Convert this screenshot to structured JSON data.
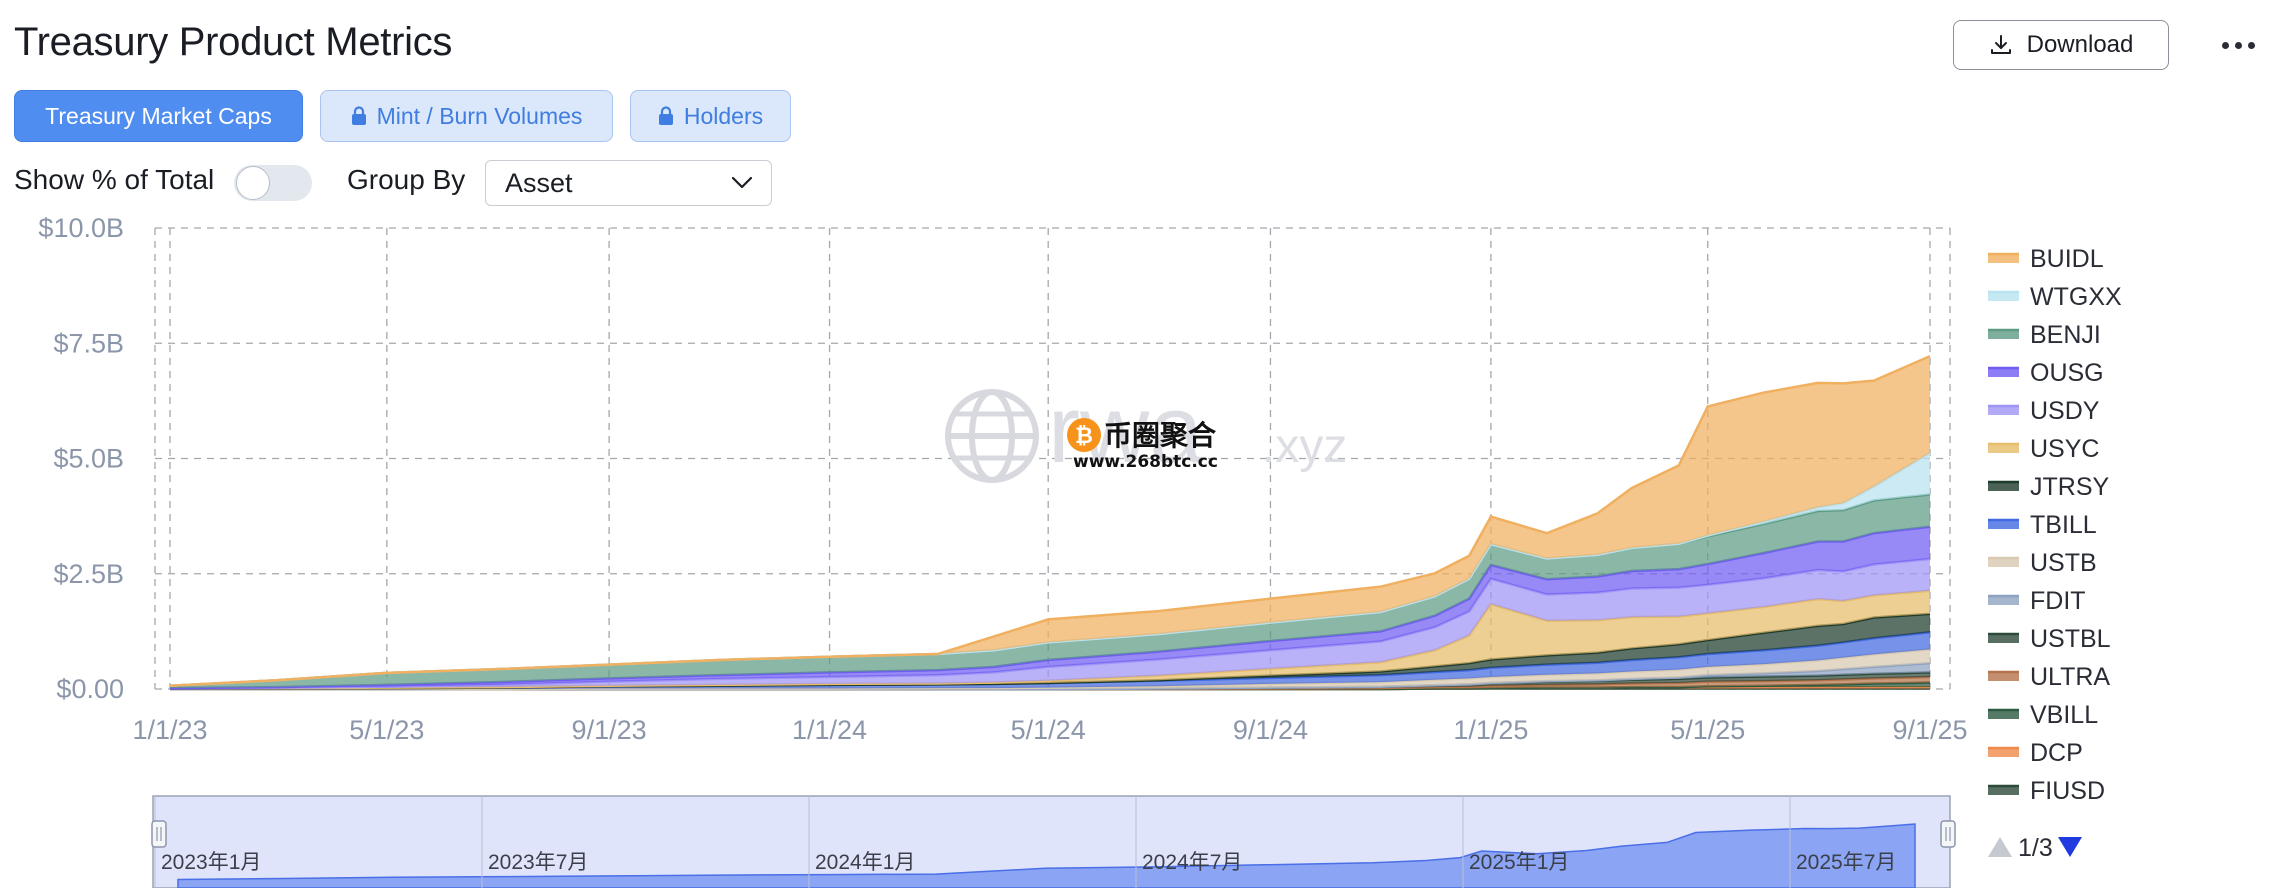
{
  "header": {
    "title": "Treasury Product Metrics",
    "download_label": "Download",
    "more_icon": "ellipsis-icon"
  },
  "tabs": [
    {
      "label": "Treasury Market Caps",
      "active": true
    },
    {
      "label": "Mint / Burn Volumes",
      "locked": true
    },
    {
      "label": "Holders",
      "locked": true
    }
  ],
  "controls": {
    "show_pct_label": "Show % of Total",
    "show_pct_on": false,
    "group_by_label": "Group By",
    "group_by_value": "Asset"
  },
  "watermark": {
    "text1": "rwa",
    "text2": ".xyz",
    "badge_text": "币圈聚合",
    "badge_url": "www.268btc.cc"
  },
  "pagination": {
    "text": "1/3"
  },
  "colors": {
    "accent": "#4f8df0"
  },
  "navigator": {
    "labels": [
      "2023年1月",
      "2023年7月",
      "2024年1月",
      "2024年7月",
      "2025年1月",
      "2025年7月"
    ]
  },
  "chart_data": {
    "type": "area",
    "stacked": true,
    "x": [
      "1/1/23",
      "3/1/23",
      "5/1/23",
      "7/1/23",
      "9/1/23",
      "11/1/23",
      "1/1/24",
      "3/1/24",
      "4/1/24",
      "5/1/24",
      "7/1/24",
      "9/1/24",
      "11/1/24",
      "12/1/24",
      "12/20/24",
      "1/1/25",
      "2/1/25",
      "3/1/25",
      "3/20/25",
      "4/15/25",
      "5/1/25",
      "6/1/25",
      "7/1/25",
      "7/15/25",
      "8/1/25",
      "9/1/25"
    ],
    "x_ticks": [
      "1/1/23",
      "5/1/23",
      "9/1/23",
      "1/1/24",
      "5/1/24",
      "9/1/24",
      "1/1/25",
      "5/1/25",
      "9/1/25"
    ],
    "y_ticks": [
      "$0.00",
      "$2.5B",
      "$5.0B",
      "$7.5B",
      "$10.0B"
    ],
    "ylim": [
      0,
      10
    ],
    "yunit": "B",
    "grid": true,
    "legend_position": "right",
    "series": [
      {
        "name": "FIUSD",
        "color": "#2d4a3a",
        "values": [
          0,
          0,
          0,
          0,
          0,
          0,
          0,
          0,
          0,
          0,
          0,
          0,
          0,
          0.01,
          0.01,
          0.01,
          0.01,
          0.01,
          0.01,
          0.01,
          0.01,
          0.01,
          0.01,
          0.01,
          0.01,
          0.01
        ]
      },
      {
        "name": "DCP",
        "color": "#f08a4b",
        "values": [
          0,
          0,
          0,
          0,
          0,
          0,
          0,
          0,
          0,
          0,
          0,
          0,
          0,
          0,
          0,
          0.01,
          0.02,
          0.02,
          0.03,
          0.03,
          0.03,
          0.03,
          0.03,
          0.03,
          0.03,
          0.03
        ]
      },
      {
        "name": "VBILL",
        "color": "#2b5a40",
        "values": [
          0,
          0,
          0,
          0,
          0,
          0,
          0,
          0,
          0,
          0,
          0,
          0,
          0,
          0,
          0,
          0,
          0,
          0,
          0,
          0,
          0.02,
          0.03,
          0.05,
          0.06,
          0.08,
          0.1
        ]
      },
      {
        "name": "ULTRA",
        "color": "#b5734a",
        "values": [
          0,
          0,
          0,
          0,
          0,
          0,
          0,
          0,
          0,
          0,
          0,
          0.01,
          0.02,
          0.03,
          0.04,
          0.05,
          0.06,
          0.07,
          0.08,
          0.09,
          0.1,
          0.1,
          0.1,
          0.11,
          0.11,
          0.12
        ]
      },
      {
        "name": "USTBL",
        "color": "#2f4a3c",
        "values": [
          0,
          0,
          0,
          0,
          0,
          0,
          0,
          0,
          0,
          0,
          0.01,
          0.02,
          0.03,
          0.04,
          0.05,
          0.06,
          0.07,
          0.08,
          0.08,
          0.09,
          0.09,
          0.1,
          0.1,
          0.1,
          0.1,
          0.1
        ]
      },
      {
        "name": "FDIT",
        "color": "#8ea2c2",
        "values": [
          0,
          0,
          0,
          0,
          0,
          0,
          0,
          0,
          0,
          0,
          0,
          0,
          0,
          0,
          0,
          0,
          0.01,
          0.01,
          0.02,
          0.03,
          0.05,
          0.07,
          0.1,
          0.12,
          0.15,
          0.2
        ]
      },
      {
        "name": "USTB",
        "color": "#d8c9b0",
        "values": [
          0,
          0,
          0,
          0,
          0.01,
          0.01,
          0.01,
          0.02,
          0.02,
          0.03,
          0.05,
          0.08,
          0.1,
          0.12,
          0.13,
          0.13,
          0.14,
          0.15,
          0.16,
          0.17,
          0.18,
          0.2,
          0.23,
          0.25,
          0.27,
          0.3
        ]
      },
      {
        "name": "TBILL",
        "color": "#4169e1",
        "values": [
          0.01,
          0.01,
          0.02,
          0.03,
          0.05,
          0.06,
          0.08,
          0.08,
          0.09,
          0.1,
          0.12,
          0.13,
          0.15,
          0.17,
          0.18,
          0.2,
          0.22,
          0.23,
          0.25,
          0.27,
          0.28,
          0.3,
          0.32,
          0.33,
          0.35,
          0.37
        ]
      },
      {
        "name": "JTRSY",
        "color": "#1f3b2d",
        "values": [
          0,
          0,
          0,
          0,
          0,
          0,
          0,
          0,
          0,
          0,
          0.01,
          0.05,
          0.08,
          0.12,
          0.15,
          0.18,
          0.2,
          0.22,
          0.25,
          0.28,
          0.3,
          0.38,
          0.43,
          0.4,
          0.45,
          0.4
        ]
      },
      {
        "name": "USYC",
        "color": "#e6bd6a",
        "values": [
          0.01,
          0.01,
          0.01,
          0.01,
          0.01,
          0.02,
          0.02,
          0.02,
          0.03,
          0.05,
          0.1,
          0.15,
          0.2,
          0.35,
          0.6,
          1.2,
          0.75,
          0.7,
          0.68,
          0.6,
          0.58,
          0.56,
          0.58,
          0.5,
          0.48,
          0.5
        ]
      },
      {
        "name": "USDY",
        "color": "#9f94f5",
        "values": [
          0,
          0.01,
          0.02,
          0.05,
          0.09,
          0.13,
          0.15,
          0.18,
          0.22,
          0.3,
          0.35,
          0.4,
          0.45,
          0.5,
          0.52,
          0.55,
          0.57,
          0.6,
          0.62,
          0.63,
          0.62,
          0.62,
          0.63,
          0.64,
          0.67,
          0.69
        ]
      },
      {
        "name": "OUSG",
        "color": "#6f5df2",
        "values": [
          0,
          0.01,
          0.04,
          0.06,
          0.07,
          0.08,
          0.1,
          0.11,
          0.12,
          0.15,
          0.17,
          0.2,
          0.22,
          0.25,
          0.28,
          0.3,
          0.33,
          0.35,
          0.38,
          0.4,
          0.45,
          0.55,
          0.62,
          0.65,
          0.68,
          0.7
        ]
      },
      {
        "name": "BENJI",
        "color": "#5e9b83",
        "values": [
          0.05,
          0.15,
          0.26,
          0.28,
          0.3,
          0.33,
          0.34,
          0.35,
          0.36,
          0.38,
          0.38,
          0.4,
          0.42,
          0.42,
          0.43,
          0.45,
          0.45,
          0.47,
          0.5,
          0.55,
          0.6,
          0.63,
          0.66,
          0.68,
          0.71,
          0.7
        ]
      },
      {
        "name": "WTGXX",
        "color": "#b8e2ef",
        "values": [
          0,
          0,
          0,
          0,
          0,
          0,
          0,
          0,
          0,
          0,
          0,
          0,
          0,
          0,
          0,
          0,
          0,
          0,
          0,
          0,
          0.02,
          0.05,
          0.08,
          0.15,
          0.3,
          0.9
        ]
      },
      {
        "name": "BUIDL",
        "color": "#f0b060",
        "values": [
          0,
          0,
          0,
          0,
          0,
          0,
          0,
          0,
          0.3,
          0.5,
          0.5,
          0.52,
          0.55,
          0.5,
          0.5,
          0.6,
          0.55,
          0.9,
          1.3,
          1.7,
          2.8,
          2.8,
          2.7,
          2.6,
          2.3,
          2.1
        ]
      }
    ]
  }
}
